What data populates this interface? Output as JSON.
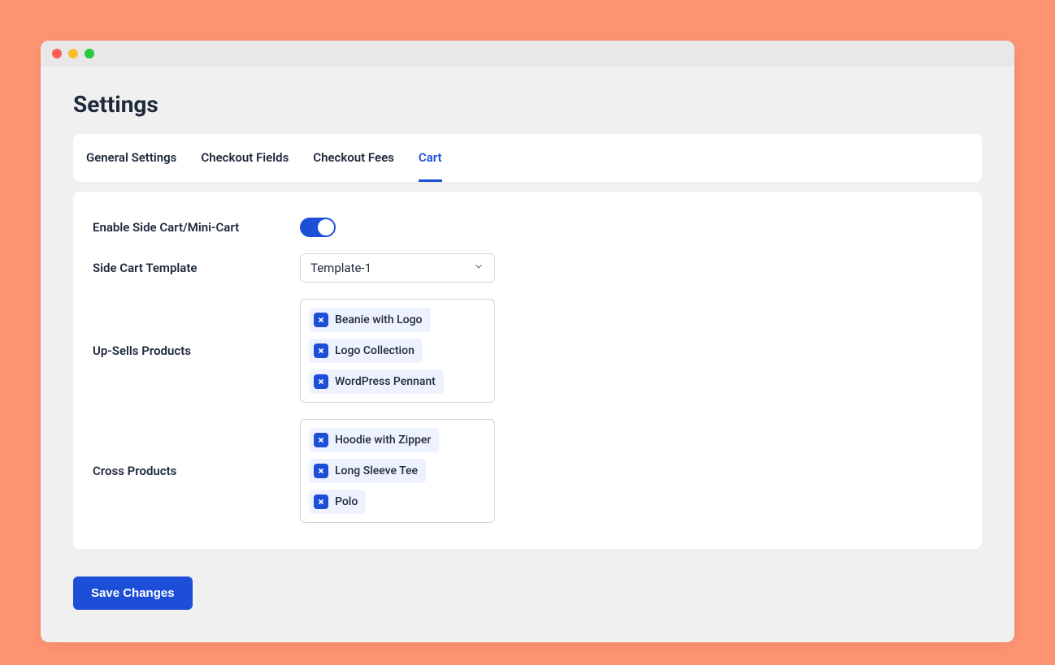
{
  "page_title": "Settings",
  "tabs": {
    "general": "General Settings",
    "checkout_fields": "Checkout Fields",
    "checkout_fees": "Checkout Fees",
    "cart": "Cart"
  },
  "labels": {
    "enable_side_cart": "Enable Side Cart/Mini-Cart",
    "side_cart_template": "Side Cart Template",
    "upsells": "Up-Sells Products",
    "cross": "Cross Products"
  },
  "template_selected": "Template-1",
  "upsell_products": {
    "0": "Beanie with Logo",
    "1": "Logo Collection",
    "2": "WordPress Pennant"
  },
  "cross_products": {
    "0": "Hoodie with Zipper",
    "1": "Long Sleeve Tee",
    "2": "Polo"
  },
  "save_button": "Save Changes"
}
